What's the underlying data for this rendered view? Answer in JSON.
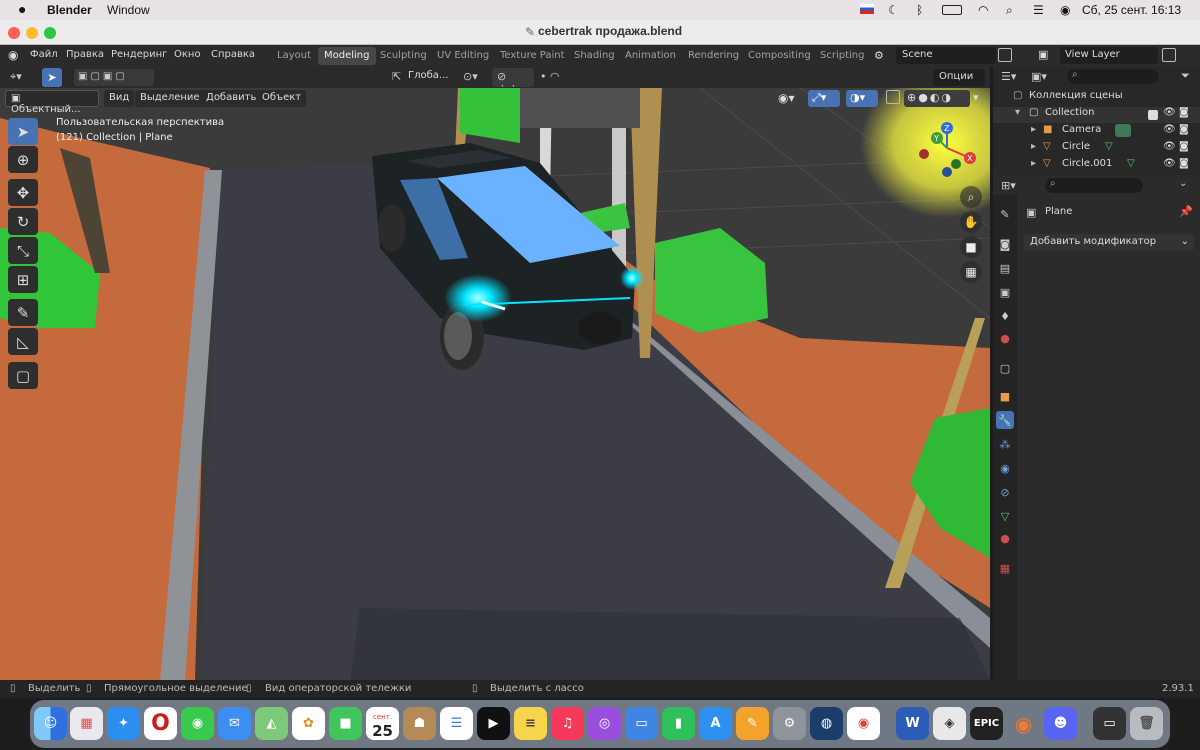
{
  "macos_menubar": {
    "apple": "",
    "app_name": "Blender",
    "window_menu": "Window",
    "date_time": "Сб, 25 сент.  16:13"
  },
  "window": {
    "title": "cebertrak продажа.blend"
  },
  "topbar": {
    "menus": [
      "Файл",
      "Правка",
      "Рендеринг",
      "Окно",
      "Справка"
    ],
    "workspaces": [
      "Layout",
      "Modeling",
      "Sculpting",
      "UV Editing",
      "Texture Paint",
      "Shading",
      "Animation",
      "Rendering",
      "Compositing",
      "Scripting"
    ],
    "active_workspace": "Modeling",
    "scene": "Scene",
    "view_layer": "View Layer"
  },
  "viewport_header": {
    "orientation": "Глоба...",
    "options": "Опции",
    "mode": "Объектный...",
    "menus": [
      "Вид",
      "Выделение",
      "Добавить",
      "Объект"
    ]
  },
  "viewport": {
    "perspective": "Пользовательская перспектива",
    "collection_info": "(121) Collection | Plane",
    "gizmo_axes": [
      "Z",
      "Y",
      "X"
    ]
  },
  "outliner": {
    "root": "Коллекция сцены",
    "items": [
      {
        "name": "Collection"
      },
      {
        "name": "Camera"
      },
      {
        "name": "Circle"
      },
      {
        "name": "Circle.001"
      }
    ]
  },
  "properties": {
    "object_name": "Plane",
    "add_modifier": "Добавить модификатор"
  },
  "statusbar": {
    "items": [
      "Выделить",
      "Прямоугольное выделение",
      "Вид операторской тележки",
      "Выделить с лассо"
    ],
    "version": "2.93.1"
  },
  "dock": {
    "calendar_month": "сент.",
    "calendar_day": "25",
    "apps": [
      "finder-icon",
      "launchpad-icon",
      "safari-icon",
      "opera-icon",
      "messages-icon",
      "mail-icon",
      "maps-icon",
      "photos-icon",
      "facetime-icon",
      "calendar-icon",
      "contacts-icon",
      "reminders-icon",
      "tv-icon",
      "notes-icon",
      "music-icon",
      "podcasts-icon",
      "keynote-icon",
      "numbers-icon",
      "appstore-icon",
      "pages-icon",
      "system-preferences-icon",
      "steam-icon",
      "chrome-icon",
      "word-icon",
      "preview-icon",
      "epic-games-icon",
      "blender-icon",
      "discord-icon",
      "screenshot-icon",
      "trash-icon"
    ]
  },
  "colors": {
    "accent": "#4772b3",
    "headlight": "#00e5ff",
    "ground": "#c56a3c",
    "road": "#3b3c45"
  }
}
